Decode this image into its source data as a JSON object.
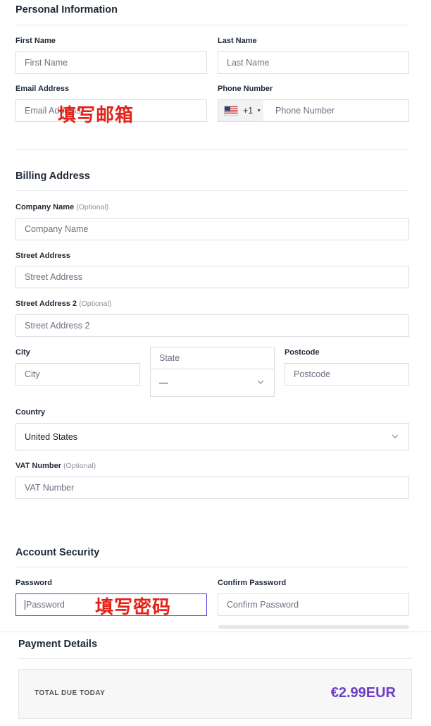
{
  "personal": {
    "title": "Personal Information",
    "first_name": {
      "label": "First Name",
      "placeholder": "First Name"
    },
    "last_name": {
      "label": "Last Name",
      "placeholder": "Last Name"
    },
    "email": {
      "label": "Email Address",
      "placeholder": "Email Address",
      "annotation": "填写邮箱"
    },
    "phone": {
      "label": "Phone Number",
      "code": "+1",
      "placeholder": "Phone Number",
      "flag_icon": "us-flag-icon"
    }
  },
  "billing": {
    "title": "Billing Address",
    "company": {
      "label": "Company Name",
      "optional": "(Optional)",
      "placeholder": "Company Name"
    },
    "street": {
      "label": "Street Address",
      "placeholder": "Street Address"
    },
    "street2": {
      "label": "Street Address 2",
      "optional": "(Optional)",
      "placeholder": "Street Address 2"
    },
    "city": {
      "label": "City",
      "placeholder": "City"
    },
    "state": {
      "placeholder": "State",
      "select_value": "—"
    },
    "postcode": {
      "label": "Postcode",
      "placeholder": "Postcode"
    },
    "country": {
      "label": "Country",
      "value": "United States"
    },
    "vat": {
      "label": "VAT Number",
      "optional": "(Optional)",
      "placeholder": "VAT Number"
    }
  },
  "security": {
    "title": "Account Security",
    "password": {
      "label": "Password",
      "placeholder": "Password",
      "annotation": "填写密码"
    },
    "confirm": {
      "label": "Confirm Password",
      "placeholder": "Confirm Password"
    }
  },
  "payment": {
    "title": "Payment Details",
    "total_label": "TOTAL DUE TODAY",
    "total_value": "€2.99EUR"
  },
  "colors": {
    "accent": "#6c3fc5",
    "annotation": "#e2231a",
    "focus_border": "#4b3bd6"
  }
}
